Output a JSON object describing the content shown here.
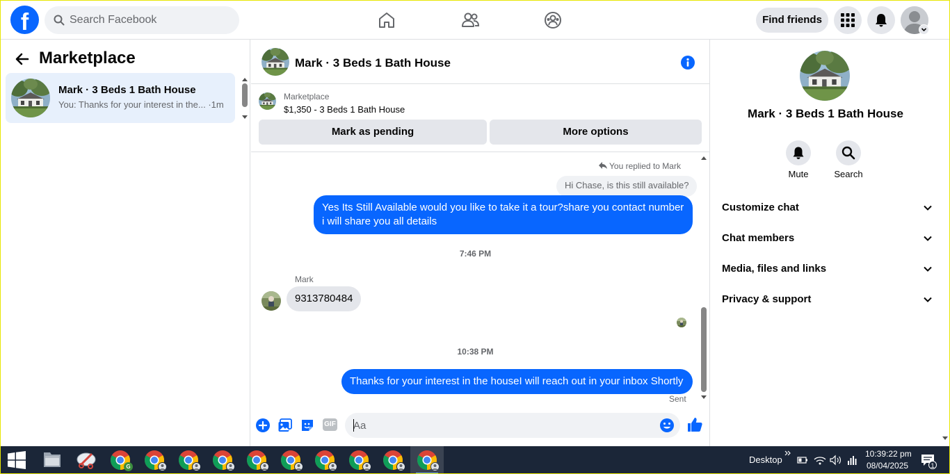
{
  "topnav": {
    "logo_letter": "f",
    "search_placeholder": "Search Facebook",
    "find_friends_label": "Find friends"
  },
  "left": {
    "title": "Marketplace",
    "conversation": {
      "name": "Mark · 3 Beds 1 Bath House",
      "preview": "You: Thanks for your interest in the... ·1m"
    }
  },
  "chat": {
    "header_name": "Mark · 3 Beds 1 Bath House",
    "listing_kicker": "Marketplace",
    "listing_desc": "$1,350 - 3 Beds 1 Bath House",
    "mark_pending_label": "Mark as pending",
    "more_options_label": "More options",
    "replied_note": "You replied to Mark",
    "quoted_text": "Hi Chase, is this still available?",
    "outgoing_1": "Yes Its Still Available would you like to take it a tour?share you contact number i will share you all details",
    "timestamp_1": "7:46 PM",
    "sender_name": "Mark",
    "incoming_1": "9313780484",
    "timestamp_2": "10:38 PM",
    "outgoing_2": "Thanks for your interest in the houseI will reach out in your inbox Shortly",
    "sent_label": "Sent",
    "composer_placeholder": "Aa",
    "gif_label": "GIF"
  },
  "right": {
    "name": "Mark · 3 Beds 1 Bath House",
    "mute_label": "Mute",
    "search_label": "Search",
    "sections": [
      "Customize chat",
      "Chat members",
      "Media, files and links",
      "Privacy & support"
    ]
  },
  "taskbar": {
    "desktop_label": "Desktop",
    "time": "10:39:22 pm",
    "date": "08/04/2025",
    "notification_count": "1",
    "chrome_badge": "G"
  },
  "colors": {
    "brand_blue": "#0866ff",
    "bubble_gray": "#e4e6eb",
    "taskbar": "#1b2638"
  }
}
